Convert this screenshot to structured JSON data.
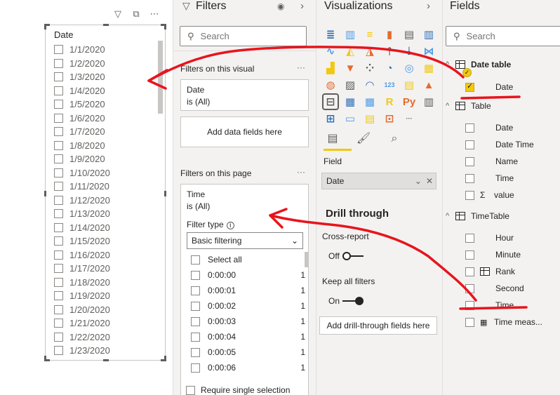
{
  "slicer": {
    "title": "Date",
    "items": [
      "1/1/2020",
      "1/2/2020",
      "1/3/2020",
      "1/4/2020",
      "1/5/2020",
      "1/6/2020",
      "1/7/2020",
      "1/8/2020",
      "1/9/2020",
      "1/10/2020",
      "1/11/2020",
      "1/12/2020",
      "1/13/2020",
      "1/14/2020",
      "1/15/2020",
      "1/16/2020",
      "1/17/2020",
      "1/18/2020",
      "1/19/2020",
      "1/20/2020",
      "1/21/2020",
      "1/22/2020",
      "1/23/2020"
    ],
    "header_icons": [
      "filter-icon",
      "focus-mode-icon",
      "more-options-icon"
    ]
  },
  "filters": {
    "title": "Filters",
    "search_placeholder": "Search",
    "on_visual_label": "Filters on this visual",
    "visual_card": {
      "name": "Date",
      "state": "is (All)"
    },
    "add_fields": "Add data fields here",
    "on_page_label": "Filters on this page",
    "page_card": {
      "name": "Time",
      "state": "is (All)"
    },
    "filter_type_label": "Filter type",
    "filter_type_value": "Basic filtering",
    "select_all": "Select all",
    "values": [
      {
        "label": "0:00:00",
        "count": "1"
      },
      {
        "label": "0:00:01",
        "count": "1"
      },
      {
        "label": "0:00:02",
        "count": "1"
      },
      {
        "label": "0:00:03",
        "count": "1"
      },
      {
        "label": "0:00:04",
        "count": "1"
      },
      {
        "label": "0:00:05",
        "count": "1"
      },
      {
        "label": "0:00:06",
        "count": "1"
      }
    ],
    "require_single": "Require single selection",
    "more": "···"
  },
  "viz": {
    "title": "Visualizations",
    "icons": [
      "stacked-bar-icon",
      "stacked-column-icon",
      "clustered-bar-icon",
      "clustered-column-icon",
      "100-bar-icon",
      "100-column-icon",
      "line-chart-icon",
      "area-chart-icon",
      "stacked-area-icon",
      "line-column-icon",
      "line-clustered-icon",
      "ribbon-chart-icon",
      "waterfall-icon",
      "funnel-icon",
      "scatter-icon",
      "pie-chart-icon",
      "donut-chart-icon",
      "treemap-icon",
      "map-icon",
      "filled-map-icon",
      "gauge-icon",
      "card-icon",
      "multi-row-card-icon",
      "kpi-icon",
      "slicer-icon",
      "table-icon",
      "matrix-icon",
      "r-visual-icon",
      "python-visual-icon",
      "key-influencers-icon",
      "decomposition-tree-icon",
      "qa-icon",
      "smart-narrative-icon",
      "paginated-report-icon",
      "more-visuals-icon"
    ],
    "icon_glyphs": [
      "≣",
      "▥",
      "≡",
      "▮",
      "▤",
      "▥",
      "∿",
      "◭",
      "◮",
      "⫯",
      "⫰",
      "⋈",
      "▟",
      "▼",
      "⁘",
      "◔",
      "◎",
      "▦",
      "◍",
      "▨",
      "◠",
      "123",
      "▤",
      "▲",
      "⊟",
      "▦",
      "▦",
      "R",
      "Py",
      "▥",
      "⊞",
      "▭",
      "▤",
      "⊡",
      "···"
    ],
    "tabs": [
      "fields-tab-icon",
      "format-tab-icon",
      "analytics-tab-icon"
    ],
    "field_label": "Field",
    "field_value": "Date",
    "drill_title": "Drill through",
    "cross_report": "Cross-report",
    "off": "Off",
    "keep_all": "Keep all filters",
    "on": "On",
    "add_drill": "Add drill-through fields here"
  },
  "fields": {
    "title": "Fields",
    "search_placeholder": "Search",
    "tables": [
      {
        "name": "Date table",
        "fields": [
          {
            "name": "Date",
            "checked": true
          }
        ]
      },
      {
        "name": "Table",
        "fields": [
          {
            "name": "Date"
          },
          {
            "name": "Date Time"
          },
          {
            "name": "Name"
          },
          {
            "name": "Time"
          },
          {
            "name": "value",
            "sigma": "Σ"
          }
        ]
      },
      {
        "name": "TimeTable",
        "fields": [
          {
            "name": "Hour"
          },
          {
            "name": "Minute"
          },
          {
            "name": "Rank"
          },
          {
            "name": "Second"
          },
          {
            "name": "Time"
          },
          {
            "name": "Time meas..."
          }
        ]
      }
    ]
  },
  "colors": {
    "accent": "#f2c811",
    "annotation": "#e8141c",
    "pane": "#f3f2f1"
  }
}
